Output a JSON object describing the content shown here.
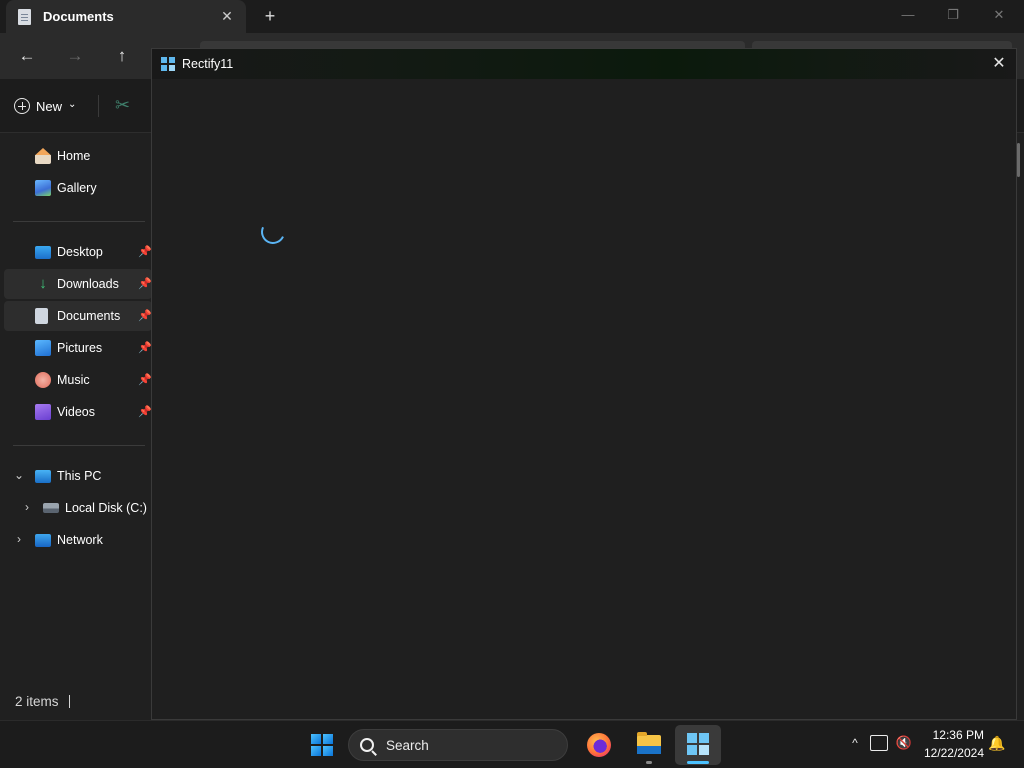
{
  "explorer": {
    "tab_title": "Documents",
    "tab_close": "✕",
    "tab_add": "+",
    "window_controls": {
      "minimize": "—",
      "maximize": "❐",
      "close": "✕"
    },
    "nav": {
      "back": "←",
      "forward": "→",
      "up": "↑"
    },
    "command_bar": {
      "new_label": "New",
      "new_chevron": "⌄",
      "cut_icon": "✂"
    },
    "sidebar": {
      "pin_glyph": "📌",
      "items": [
        {
          "label": "Home",
          "icon": "home-icon"
        },
        {
          "label": "Gallery",
          "icon": "gallery-icon"
        },
        {
          "label": "Desktop",
          "icon": "desktop-icon",
          "pinned": true
        },
        {
          "label": "Downloads",
          "icon": "downloads-icon",
          "pinned": true,
          "selected": true
        },
        {
          "label": "Documents",
          "icon": "documents-icon",
          "pinned": true,
          "selected": true
        },
        {
          "label": "Pictures",
          "icon": "pictures-icon",
          "pinned": true
        },
        {
          "label": "Music",
          "icon": "music-icon",
          "pinned": true
        },
        {
          "label": "Videos",
          "icon": "videos-icon",
          "pinned": true
        },
        {
          "label": "This PC",
          "icon": "this-pc-icon",
          "chevron": "⌄"
        },
        {
          "label": "Local Disk (C:)",
          "icon": "local-disk-icon",
          "chevron": "›"
        },
        {
          "label": "Network",
          "icon": "network-icon",
          "chevron": "›"
        }
      ]
    },
    "status": {
      "items_count": "2 items"
    }
  },
  "dialog": {
    "title": "Rectify11",
    "close": "✕",
    "icon": "rectify11-logo-icon",
    "state": "loading"
  },
  "taskbar": {
    "search_label": "Search",
    "apps": [
      "start-icon",
      "firefox-icon",
      "file-explorer-icon",
      "rectify11-icon"
    ],
    "tray": {
      "chevron": "^",
      "volume": "🔇",
      "bell": "🔔",
      "time": "12:36 PM",
      "date": "12/22/2024"
    }
  },
  "colors": {
    "accent": "#4cc2ff",
    "window_bg": "#202020",
    "taskbar_bg": "#1c1c1c",
    "spinner": "#5ab4f3"
  }
}
